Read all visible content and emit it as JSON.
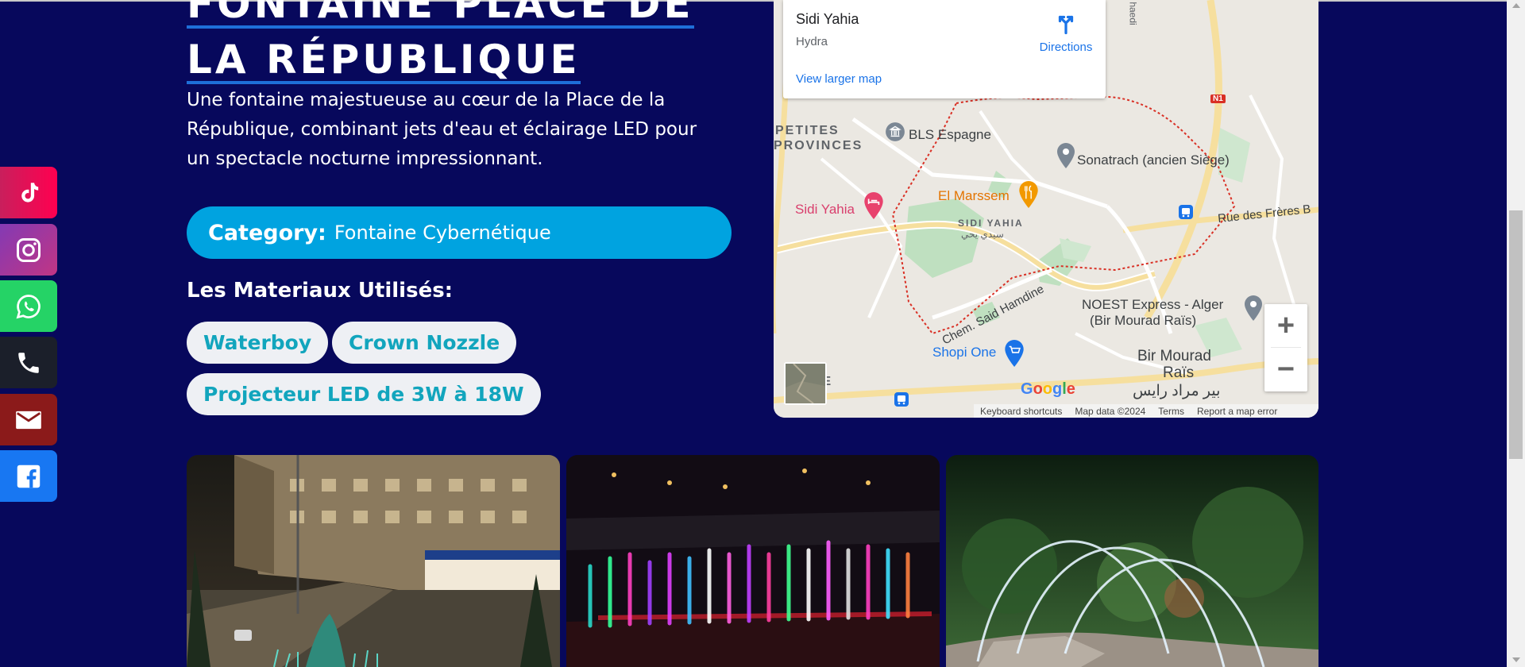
{
  "page": {
    "title_line1": "FONTAINE PLACE DE",
    "title_line2": "LA RÉPUBLIQUE",
    "description": "Une fontaine majestueuse au cœur de la Place de la République, combinant jets d'eau et éclairage LED pour un spectacle nocturne impressionnant.",
    "category_label": "Category:",
    "category_value": "Fontaine Cybernétique",
    "materials_heading": "Les Materiaux Utilisés:",
    "materials": [
      "Waterboy",
      "Crown Nozzle",
      "Projecteur LED de 3W à 18W"
    ]
  },
  "social": [
    {
      "name": "tiktok-icon"
    },
    {
      "name": "instagram-icon"
    },
    {
      "name": "whatsapp-icon"
    },
    {
      "name": "phone-icon"
    },
    {
      "name": "mail-icon"
    },
    {
      "name": "facebook-icon"
    }
  ],
  "map": {
    "place_name": "Sidi Yahia",
    "place_area": "Hydra",
    "directions_label": "Directions",
    "larger_map_label": "View larger map",
    "zoom_in": "+",
    "zoom_out": "−",
    "google": "Google",
    "attribution": [
      "Keyboard shortcuts",
      "Map data ©2024",
      "Terms",
      "Report a map error"
    ],
    "labels": {
      "petites_provinces_1": "PETITES",
      "petites_provinces_2": "PROVINCES",
      "bls": "BLS Espagne",
      "sonatrach": "Sonatrach (ancien Siège)",
      "el_marssem": "El Marssem",
      "sidi_yahia_district": "SIDI YAHIA",
      "sidi_yahia_arabic": "سيدي يحي",
      "sidi_yahia_pin": "Sidi Yahia",
      "rue_freres": "Rue des Frères B",
      "chem_said": "Chem. Said Hamdine",
      "noest_1": "NOEST Express - Alger",
      "noest_2": "(Bir Mourad Raïs)",
      "shopi": "Shopi One",
      "bir_mourad_1": "Bir Mourad",
      "bir_mourad_2": "Raïs",
      "bir_mourad_arabic": "بير مراد رايس",
      "dine": "DINE",
      "n1": "N1",
      "haedi": "haedi"
    }
  },
  "gallery": [
    {
      "name": "gallery-image-street-fountain"
    },
    {
      "name": "gallery-image-led-fountain"
    },
    {
      "name": "gallery-image-arc-jets"
    }
  ]
}
